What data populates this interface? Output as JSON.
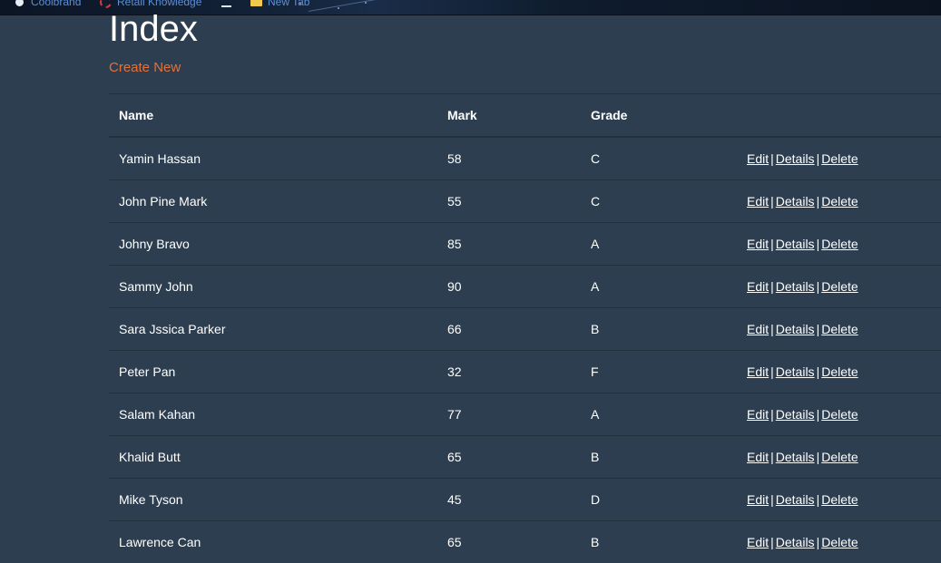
{
  "bookmarks": [
    {
      "label": "Coolbrand",
      "icon": "circle-logo-icon"
    },
    {
      "label": "Retail Knowledge",
      "icon": "retail-logo-icon"
    },
    {
      "label": "",
      "icon": "list-icon"
    },
    {
      "label": "New Tab",
      "icon": "folder-icon"
    }
  ],
  "page": {
    "title": "Index",
    "create_link": "Create New"
  },
  "table": {
    "headers": [
      "Name",
      "Mark",
      "Grade",
      ""
    ],
    "action_labels": {
      "edit": "Edit",
      "details": "Details",
      "delete": "Delete",
      "separator": "|"
    },
    "rows": [
      {
        "name": "Yamin Hassan",
        "mark": "58",
        "grade": "C"
      },
      {
        "name": "John Pine Mark",
        "mark": "55",
        "grade": "C"
      },
      {
        "name": "Johny Bravo",
        "mark": "85",
        "grade": "A"
      },
      {
        "name": "Sammy John",
        "mark": "90",
        "grade": "A"
      },
      {
        "name": "Sara Jssica Parker",
        "mark": "66",
        "grade": "B"
      },
      {
        "name": "Peter Pan",
        "mark": "32",
        "grade": "F"
      },
      {
        "name": "Salam Kahan",
        "mark": "77",
        "grade": "A"
      },
      {
        "name": "Khalid Butt",
        "mark": "65",
        "grade": "B"
      },
      {
        "name": "Mike Tyson",
        "mark": "45",
        "grade": "D"
      },
      {
        "name": "Lawrence Can",
        "mark": "65",
        "grade": "B"
      }
    ]
  },
  "colors": {
    "background": "#2c3e50",
    "link_accent": "#e5703a",
    "bookmark_text": "#5b8fd8"
  }
}
